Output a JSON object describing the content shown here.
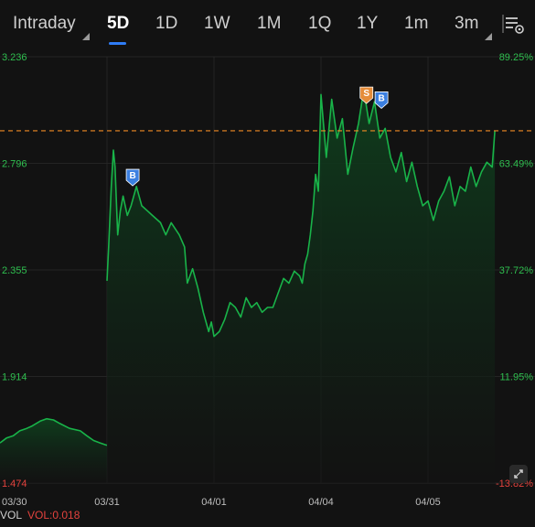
{
  "tabs": {
    "items": [
      "Intraday",
      "5D",
      "1D",
      "1W",
      "1M",
      "1Q",
      "1Y",
      "1m",
      "3m"
    ],
    "active": "5D"
  },
  "colors": {
    "line": "#19b349",
    "fill": "#0f3d1d",
    "up": "#2fbf4f",
    "down": "#e3423d",
    "reference": "#f08a24",
    "accent": "#2f7df6",
    "marker_buy": "#3b7fe0",
    "marker_sell": "#e58c3a"
  },
  "icons": {
    "settings": "chart-settings-icon",
    "expand": "expand-icon",
    "dropdown": "dropdown-caret-icon"
  },
  "chart_data": {
    "type": "line",
    "title": "",
    "xlabel": "",
    "ylabel": "",
    "y_ticks_left": [
      "3.236",
      "2.796",
      "2.355",
      "1.914",
      "1.474"
    ],
    "y_ticks_right": [
      "89.25%",
      "63.49%",
      "37.72%",
      "11.95%",
      "-13.82%"
    ],
    "ylim": [
      1.474,
      3.236
    ],
    "x_ticks": [
      "03/30",
      "03/31",
      "04/01",
      "04/04",
      "04/05"
    ],
    "reference_value": 2.93,
    "grid": true,
    "series": [
      {
        "segments": [
          {
            "x": [
              0,
              0.012,
              0.025,
              0.037,
              0.05,
              0.06,
              0.075,
              0.087,
              0.1,
              0.112,
              0.13,
              0.15,
              0.162,
              0.175,
              0.187,
              0.2
            ],
            "y": [
              1.64,
              1.66,
              1.67,
              1.69,
              1.7,
              1.71,
              1.73,
              1.74,
              1.735,
              1.72,
              1.7,
              1.69,
              1.67,
              1.65,
              1.64,
              1.63
            ]
          },
          {
            "x": [
              0.2,
              0.203,
              0.208,
              0.212,
              0.215,
              0.22,
              0.225,
              0.23,
              0.238,
              0.245,
              0.255,
              0.265,
              0.275,
              0.285,
              0.3,
              0.31,
              0.32,
              0.335,
              0.345,
              0.35,
              0.36,
              0.37,
              0.38,
              0.39,
              0.395,
              0.4,
              0.41,
              0.42,
              0.43,
              0.44,
              0.45,
              0.46,
              0.47,
              0.48,
              0.49,
              0.5,
              0.51,
              0.52,
              0.53,
              0.54,
              0.55,
              0.56,
              0.565,
              0.57,
              0.575,
              0.58,
              0.585,
              0.59,
              0.595,
              0.6,
              0.61,
              0.62,
              0.63,
              0.64,
              0.65,
              0.66,
              0.67,
              0.68,
              0.69,
              0.7,
              0.71,
              0.72,
              0.73,
              0.74,
              0.75,
              0.76,
              0.77,
              0.78,
              0.79,
              0.8,
              0.81,
              0.82,
              0.83,
              0.84,
              0.85,
              0.86,
              0.87,
              0.88,
              0.89,
              0.9,
              0.91,
              0.92,
              0.925
            ],
            "y": [
              2.31,
              2.45,
              2.7,
              2.85,
              2.78,
              2.5,
              2.6,
              2.66,
              2.58,
              2.62,
              2.7,
              2.62,
              2.6,
              2.58,
              2.55,
              2.5,
              2.55,
              2.5,
              2.45,
              2.3,
              2.36,
              2.28,
              2.18,
              2.1,
              2.14,
              2.08,
              2.1,
              2.15,
              2.22,
              2.2,
              2.16,
              2.24,
              2.2,
              2.22,
              2.18,
              2.2,
              2.2,
              2.26,
              2.32,
              2.3,
              2.35,
              2.33,
              2.3,
              2.38,
              2.42,
              2.5,
              2.6,
              2.75,
              2.68,
              3.08,
              2.82,
              3.06,
              2.9,
              2.98,
              2.75,
              2.86,
              2.96,
              3.1,
              2.96,
              3.05,
              2.9,
              2.94,
              2.82,
              2.76,
              2.84,
              2.72,
              2.8,
              2.7,
              2.62,
              2.64,
              2.56,
              2.64,
              2.68,
              2.74,
              2.62,
              2.7,
              2.68,
              2.78,
              2.7,
              2.76,
              2.8,
              2.78,
              2.93
            ]
          }
        ]
      }
    ],
    "markers": [
      {
        "label": "B",
        "x": 0.248,
        "y": 2.68,
        "color": "#3b7fe0"
      },
      {
        "label": "S",
        "x": 0.685,
        "y": 3.02,
        "color": "#e58c3a"
      },
      {
        "label": "B",
        "x": 0.713,
        "y": 3.0,
        "color": "#3b7fe0"
      }
    ]
  },
  "volume": {
    "label": "VOL",
    "value": "VOL:0.018"
  }
}
